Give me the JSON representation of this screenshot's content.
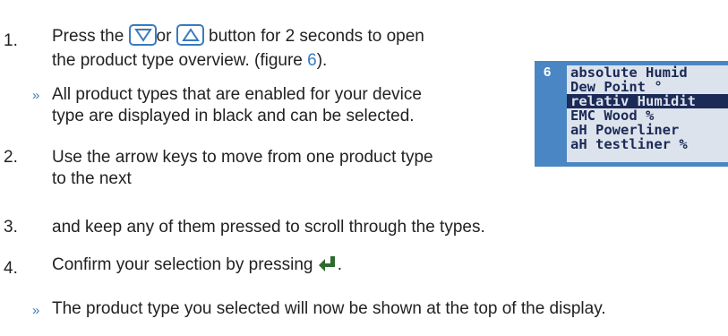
{
  "steps": [
    {
      "num": "1.",
      "pre": "Press the",
      "or": "or",
      "post": "button for 2 seconds to open",
      "line2_pre": "the product type overview. (figure ",
      "figref": "6",
      "line2_post": ")."
    },
    {
      "num": "2.",
      "line1": "Use the arrow keys to move from one product type",
      "line2": "to the next"
    },
    {
      "num": "3.",
      "line1": "and keep any of them pressed to scroll through the types."
    },
    {
      "num": "4.",
      "pre": "Confirm your selection by pressing",
      "post": "."
    }
  ],
  "notes": [
    {
      "bullet": "»",
      "line1": "All product types that are enabled for your device",
      "line2": "type are displayed in black and can be selected."
    },
    {
      "bullet": "»",
      "line1": "The product type you selected will now be shown at the top of the display."
    }
  ],
  "figure": {
    "number": "6",
    "rows": [
      "absolute Humid",
      "Dew Point    °",
      "relativ Humidit",
      "EMC Wood      %",
      "aH Powerliner",
      "aH testliner  %"
    ],
    "selected_row": 2
  },
  "colors": {
    "accent": "#3a7bbf",
    "lcd_bg": "#dde3ec",
    "lcd_text": "#1b2a57"
  },
  "icons": {
    "down": "down-triangle-icon",
    "up": "up-triangle-icon",
    "enter": "enter-key-icon"
  }
}
